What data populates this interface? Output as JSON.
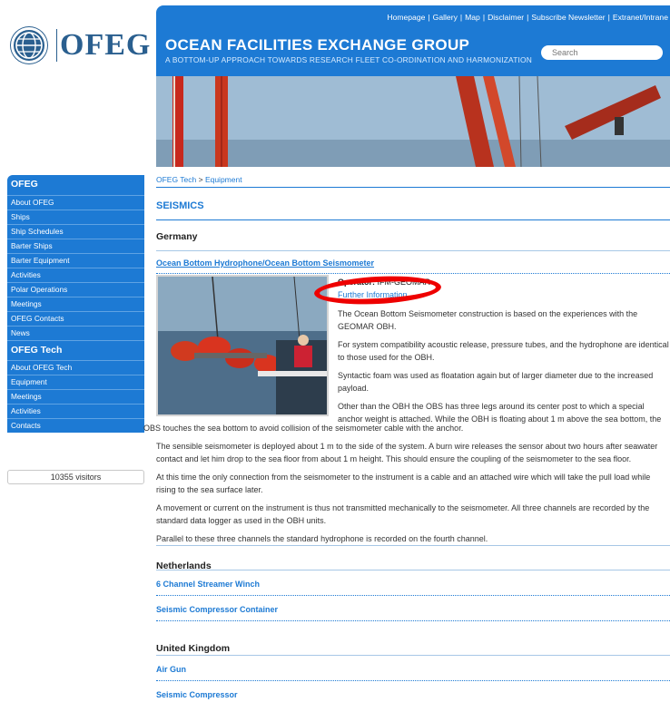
{
  "header": {
    "links": [
      "Homepage",
      "Gallery",
      "Map",
      "Disclaimer",
      "Subscribe Newsletter",
      "Extranet/Intrane"
    ],
    "logo_text": "OFEG",
    "title": "OCEAN FACILITIES EXCHANGE GROUP",
    "subtitle": "A BOTTOM-UP APPROACH TOWARDS RESEARCH FLEET CO-ORDINATION AND HARMONIZATION",
    "search_placeholder": "Search"
  },
  "sidebar": {
    "sections": [
      {
        "title": "OFEG",
        "items": [
          "About OFEG",
          "Ships",
          "Ship Schedules",
          "Barter Ships",
          "Barter Equipment",
          "Activities",
          "Polar Operations",
          "Meetings",
          "OFEG Contacts",
          "News"
        ]
      },
      {
        "title": "OFEG Tech",
        "items": [
          "About OFEG Tech",
          "Equipment",
          "Meetings",
          "Activities",
          "Contacts"
        ]
      }
    ],
    "visitors": "10355 visitors"
  },
  "main": {
    "breadcrumb": {
      "part1": "OFEG Tech",
      "sep": " > ",
      "part2": "Equipment"
    },
    "section_title": "SEISMICS",
    "germany": {
      "country": "Germany",
      "item_title": "Ocean Bottom Hydrophone/Ocean Bottom Seismometer",
      "operator_label": "Operator:",
      "operator_value": "IFM-GEOMAR",
      "further_info": "Further Information",
      "paragraphs": [
        "The Ocean Bottom Seismometer construction is based on the experiences with the GEOMAR OBH.",
        "For system compatibility acoustic release, pressure tubes, and the hydrophone are identical to those used for the OBH.",
        "Syntactic foam was used as floatation again but of larger diameter due to the increased payload.",
        "Other than the OBH the OBS has three legs around its center post to which a special anchor weight is attached. While the OBH is floating about 1 m above the sea bottom, the",
        "OBS touches the sea bottom to avoid collision of the seismometer cable with the anchor.",
        "The sensible seismometer is deployed about 1 m to the side of the system. A burn wire releases the sensor about two hours after seawater contact and let him drop to the sea floor from about 1 m height. This should ensure the coupling of the seismometer to the sea floor.",
        "At this time the only connection from the seismometer to the instrument is a cable and an attached wire which will take the pull load while rising to the sea surface later.",
        "A movement or current on the instrument is thus not transmitted mechanically to the seismometer. All three channels are recorded by the standard data logger as used in the OBH units.",
        "Parallel to these three channels the standard hydrophone is recorded on the fourth channel."
      ]
    },
    "netherlands": {
      "country": "Netherlands",
      "items": [
        "6 Channel Streamer Winch",
        "Seismic Compressor Container"
      ]
    },
    "uk": {
      "country": "United Kingdom",
      "items": [
        "Air Gun",
        "Seismic Compressor"
      ]
    }
  }
}
